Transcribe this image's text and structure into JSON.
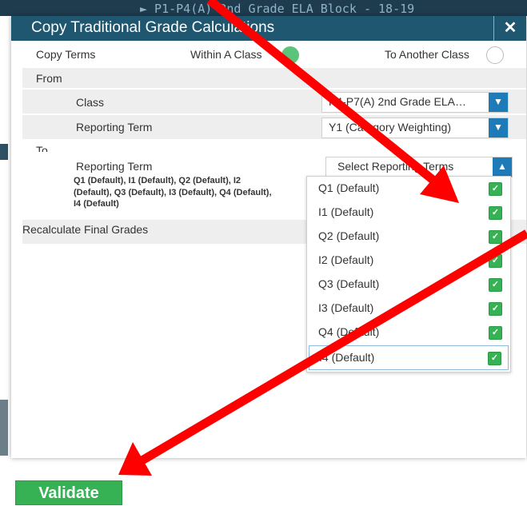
{
  "background": {
    "title": "► P1-P4(A) 2nd Grade ELA Block - 18-19"
  },
  "dialog": {
    "title": "Copy Traditional Grade Calculations",
    "close_symbol": "✕",
    "copy_terms": {
      "label": "Copy Terms",
      "option_within": "Within A Class",
      "option_another": "To Another Class",
      "selected": "Within A Class"
    },
    "from": {
      "label": "From",
      "class_label": "Class",
      "class_value": "P4-P7(A) 2nd Grade ELA…",
      "term_label": "Reporting Term",
      "term_value": "Y1 (Category Weighting)"
    },
    "to": {
      "label": "To",
      "term_label": "Reporting Term",
      "select_placeholder": "Select Reporting Terms",
      "summary": "Q1 (Default), I1 (Default), Q2 (Default), I2 (Default), Q3 (Default), I3 (Default), Q4 (Default), I4 (Default)"
    },
    "recalculate_label": "Recalculate Final Grades",
    "dropdown_options": [
      {
        "label": "Q1 (Default)",
        "checked": true
      },
      {
        "label": "I1 (Default)",
        "checked": true
      },
      {
        "label": "Q2 (Default)",
        "checked": true
      },
      {
        "label": "I2 (Default)",
        "checked": true
      },
      {
        "label": "Q3 (Default)",
        "checked": true
      },
      {
        "label": "I3 (Default)",
        "checked": true
      },
      {
        "label": "Q4 (Default)",
        "checked": true
      },
      {
        "label": "I4 (Default)",
        "checked": true
      }
    ],
    "checkmark_symbol": "✓",
    "chevron_down": "▼",
    "chevron_up": "▲"
  },
  "validate_button": {
    "label": "Validate"
  },
  "colors": {
    "title_bar": "#1f5670",
    "accent_blue": "#1f7ab8",
    "check_green": "#36b153",
    "annotation_arrow": "#ff0000"
  },
  "icons": [
    "close-icon",
    "chevron-down-icon",
    "chevron-up-icon",
    "checkbox-checked-icon",
    "annotation-arrow-icon"
  ]
}
